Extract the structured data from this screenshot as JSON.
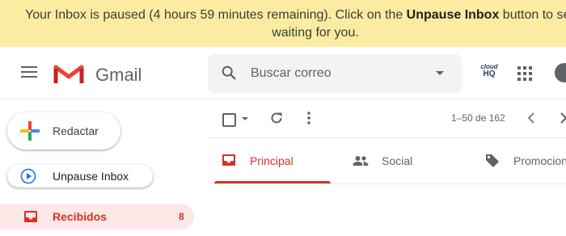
{
  "banner": {
    "prefix": "Your Inbox is paused (4 hours 59 minutes remaining). Click on the ",
    "strong": "Unpause Inbox",
    "suffix": " button to see",
    "line2": "waiting for you."
  },
  "header": {
    "app_name": "Gmail",
    "search_placeholder": "Buscar correo",
    "cloudhq_line1": "cloud",
    "cloudhq_line2": "HQ"
  },
  "sidebar": {
    "compose_label": "Redactar",
    "unpause_label": "Unpause Inbox",
    "items": [
      {
        "label": "Recibidos",
        "count": "8"
      }
    ]
  },
  "toolbar": {
    "pagination": "1–50 de 162"
  },
  "tabs": [
    {
      "label": "Principal",
      "icon": "inbox-icon",
      "active": true
    },
    {
      "label": "Social",
      "icon": "people-icon",
      "active": false
    },
    {
      "label": "Promociones",
      "icon": "tag-icon",
      "active": false
    }
  ],
  "colors": {
    "banner_bg": "#fbeca1",
    "accent_red": "#d93025",
    "selected_bg": "#fce8e6",
    "unpause_blue": "#1a73e8"
  }
}
